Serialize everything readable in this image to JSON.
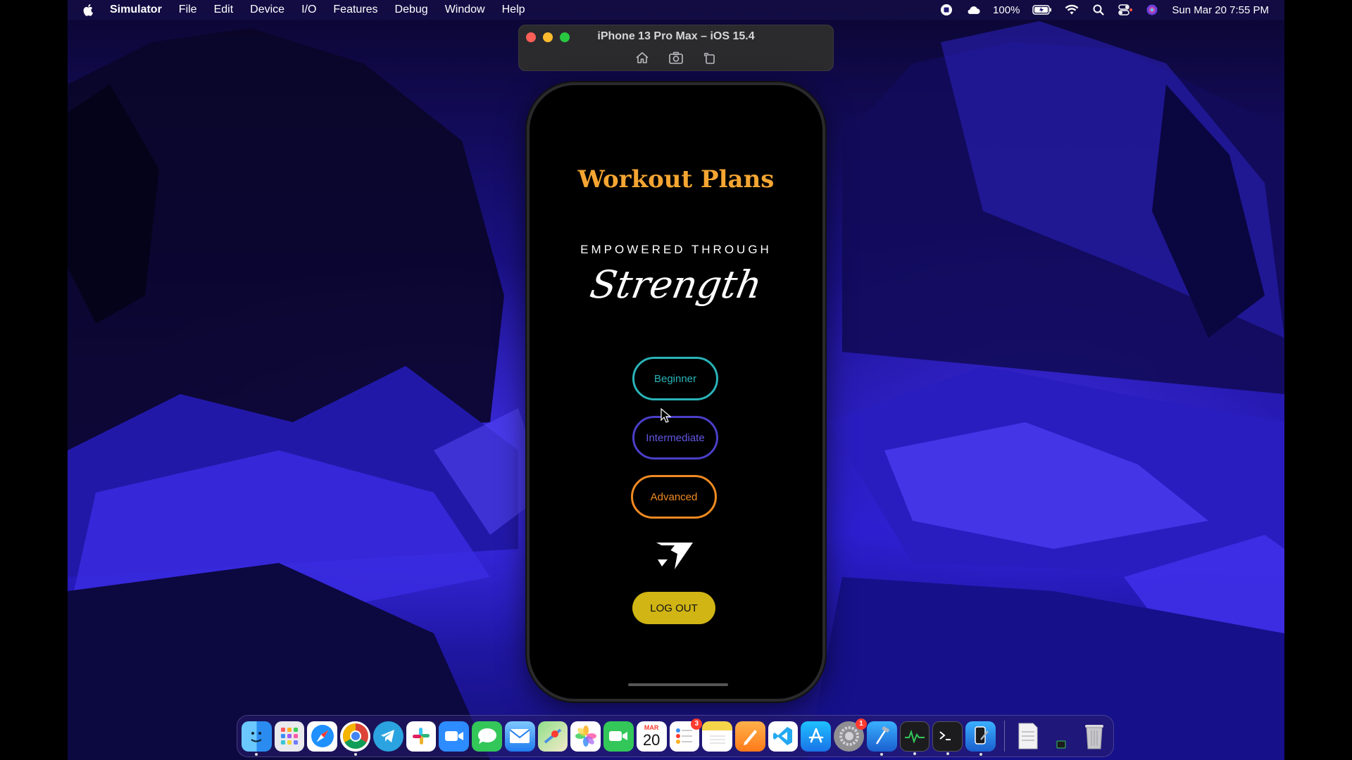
{
  "menubar": {
    "app_name": "Simulator",
    "menus": [
      "File",
      "Edit",
      "Device",
      "I/O",
      "Features",
      "Debug",
      "Window",
      "Help"
    ],
    "battery": "100%",
    "datetime": "Sun Mar 20  7:55 PM"
  },
  "simulator": {
    "title": "iPhone 13 Pro Max – iOS 15.4",
    "toolbar": [
      "home-icon",
      "screenshot-icon",
      "rotate-icon"
    ]
  },
  "app": {
    "title": "Workout Plans",
    "tagline": "EMPOWERED THROUGH",
    "script_word": "Strength",
    "levels": [
      "Beginner",
      "Intermediate",
      "Advanced"
    ],
    "logout_label": "LOG OUT",
    "colors": {
      "title": "#f4a532",
      "beginner": "#2ab3b8",
      "intermediate": "#6256e6",
      "advanced": "#f08a22",
      "logout": "#d0b514"
    }
  },
  "dock": {
    "calendar_month": "MAR",
    "calendar_day": "20",
    "reminders_badge": "3",
    "settings_badge": "1",
    "apps": [
      "finder",
      "launchpad",
      "safari",
      "chrome",
      "telegram",
      "slack",
      "zoom",
      "messages",
      "mail",
      "maps",
      "photos",
      "facetime",
      "calendar",
      "reminders",
      "notes",
      "pages",
      "vscode",
      "app-store",
      "system-preferences",
      "xcode",
      "activity-monitor",
      "terminal",
      "simulator",
      "preview",
      "trash"
    ]
  }
}
